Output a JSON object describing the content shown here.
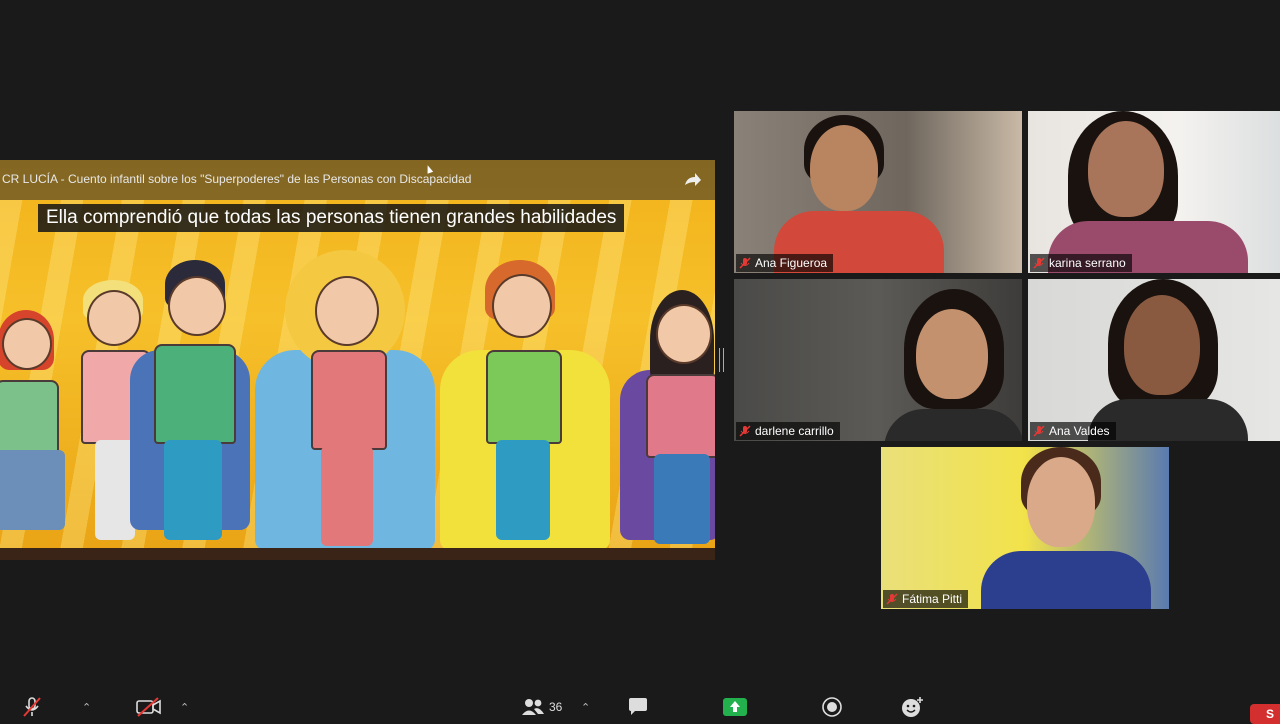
{
  "share": {
    "title": "CR LUCÍA - Cuento infantil sobre los \"Superpoderes\" de las Personas con Discapacidad",
    "caption": "Ella comprendió que todas las personas tienen grandes habilidades"
  },
  "participants": [
    {
      "name": "Ana Figueroa",
      "muted": true
    },
    {
      "name": "karina serrano",
      "muted": true
    },
    {
      "name": "darlene carrillo",
      "muted": true
    },
    {
      "name": "Ana Valdes",
      "muted": true
    },
    {
      "name": "Fátima Pitti",
      "muted": true
    }
  ],
  "toolbar": {
    "participant_count": "36",
    "end_label": "S"
  },
  "colors": {
    "background": "#1a1a1a",
    "muted_red": "#e53935",
    "share_green": "#22b14c",
    "end_red": "#d32f2f"
  },
  "icons": [
    "mic-muted-icon",
    "video-off-icon",
    "participants-icon",
    "chat-icon",
    "share-screen-icon",
    "record-icon",
    "reactions-icon"
  ]
}
